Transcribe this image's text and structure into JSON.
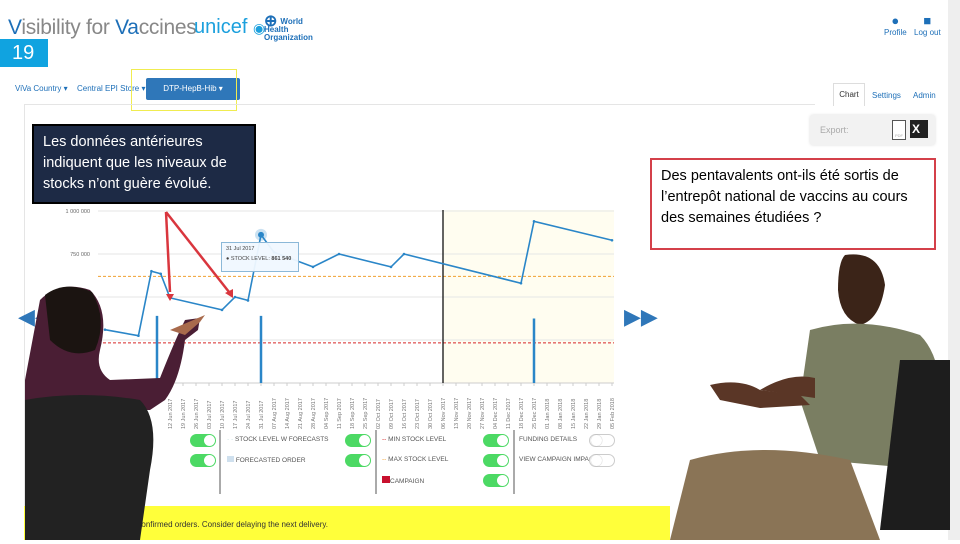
{
  "header": {
    "logo_v1": "V",
    "logo_rest1": "isibility for ",
    "logo_v2": "Va",
    "logo_rest2": "ccines",
    "unicef": "unicef",
    "who_line1": "World Health",
    "who_line2": "Organization",
    "profile": "Profile",
    "logout": "Log out"
  },
  "slide_number": "19",
  "nav": {
    "country": "ViVa Country ▾",
    "store": "Central EPI Store ▾",
    "vaccine": "DTP-HepB-Hib ▾"
  },
  "tabs": [
    {
      "label": "Chart",
      "active": true
    },
    {
      "label": "Settings"
    },
    {
      "label": "Admin"
    }
  ],
  "export": {
    "label": "Export:",
    "pdf": "PDF",
    "xls": "X"
  },
  "callouts": {
    "left": "Les données antérieures indiquent que les niveaux de stocks n’ont guère évolué.",
    "right": "Des pentavalents ont-ils été sortis de l’entrepôt national de vaccins au cours des semaines étudiées ?"
  },
  "tooltip": {
    "date": "31 Jul 2017",
    "label": "STOCK LEVEL:",
    "value": "861 540"
  },
  "legend": {
    "stock_forecast": "STOCK LEVEL W FORECASTS",
    "forecasted_order": "FORECASTED ORDER",
    "min": "MIN STOCK LEVEL",
    "max": "MAX STOCK LEVEL",
    "campaign": "CAMPAIGN",
    "funding": "FUNDING DETAILS",
    "campaign_impact": "VIEW CAMPAIGN IMPACT"
  },
  "toggles": {
    "col1a": true,
    "col1b": true,
    "stock_forecast": true,
    "forecasted_order": true,
    "min": true,
    "max": true,
    "campaign": true,
    "funding": false,
    "campaign_impact": false
  },
  "banner": "Overstocked! You also have confirmed orders. Consider delaying the next delivery.",
  "colors": {
    "accent": "#2f77b9",
    "line": "#2a86c8",
    "min": "#d62728",
    "max": "#f0a030",
    "toggle_on": "#4cd964",
    "banner": "#ffff3a",
    "forecast_zone": "#fffdf0"
  },
  "chart_data": {
    "type": "line",
    "ylim": [
      0,
      1000000
    ],
    "yticks": [
      {
        "value": 1000000,
        "label": "1 000 000"
      },
      {
        "value": 750000,
        "label": "750 000"
      }
    ],
    "xticks": [
      "12 Jun 2017",
      "19 Jun 2017",
      "26 Jun 2017",
      "03 Jul 2017",
      "10 Jul 2017",
      "17 Jul 2017",
      "24 Jul 2017",
      "31 Jul 2017",
      "07 Aug 2017",
      "14 Aug 2017",
      "21 Aug 2017",
      "28 Aug 2017",
      "04 Sep 2017",
      "11 Sep 2017",
      "18 Sep 2017",
      "25 Sep 2017",
      "02 Oct 2017",
      "09 Oct 2017",
      "16 Oct 2017",
      "23 Oct 2017",
      "30 Oct 2017",
      "06 Nov 2017",
      "13 Nov 2017",
      "20 Nov 2017",
      "27 Nov 2017",
      "04 Dec 2017",
      "11 Dec 2017",
      "18 Dec 2017",
      "25 Dec 2017",
      "01 Jan 2018",
      "08 Jan 2018",
      "15 Jan 2018",
      "22 Jan 2018",
      "29 Jan 2018",
      "05 Feb 2018"
    ],
    "stock_level": [
      [
        "2017-05-08",
        310000
      ],
      [
        "2017-05-26",
        275000
      ],
      [
        "2017-06-02",
        650000
      ],
      [
        "2017-06-07",
        635000
      ],
      [
        "2017-06-12",
        495000
      ],
      [
        "2017-07-10",
        425000
      ],
      [
        "2017-07-17",
        500000
      ],
      [
        "2017-07-24",
        480000
      ],
      [
        "2017-07-31",
        861540
      ],
      [
        "2017-08-07",
        760000
      ],
      [
        "2017-08-28",
        675000
      ],
      [
        "2017-09-11",
        750000
      ],
      [
        "2017-10-09",
        675000
      ],
      [
        "2017-10-16",
        750000
      ],
      [
        "2017-12-18",
        580000
      ],
      [
        "2017-12-25",
        940000
      ],
      [
        "2018-02-05",
        830000
      ]
    ],
    "orders": [
      [
        "2017-06-05",
        390000
      ],
      [
        "2017-07-31",
        390000
      ],
      [
        "2017-12-25",
        375000
      ]
    ],
    "min_stock": 233000,
    "max_stock": 620000,
    "current_date": "2017-11-06",
    "grid": true
  }
}
